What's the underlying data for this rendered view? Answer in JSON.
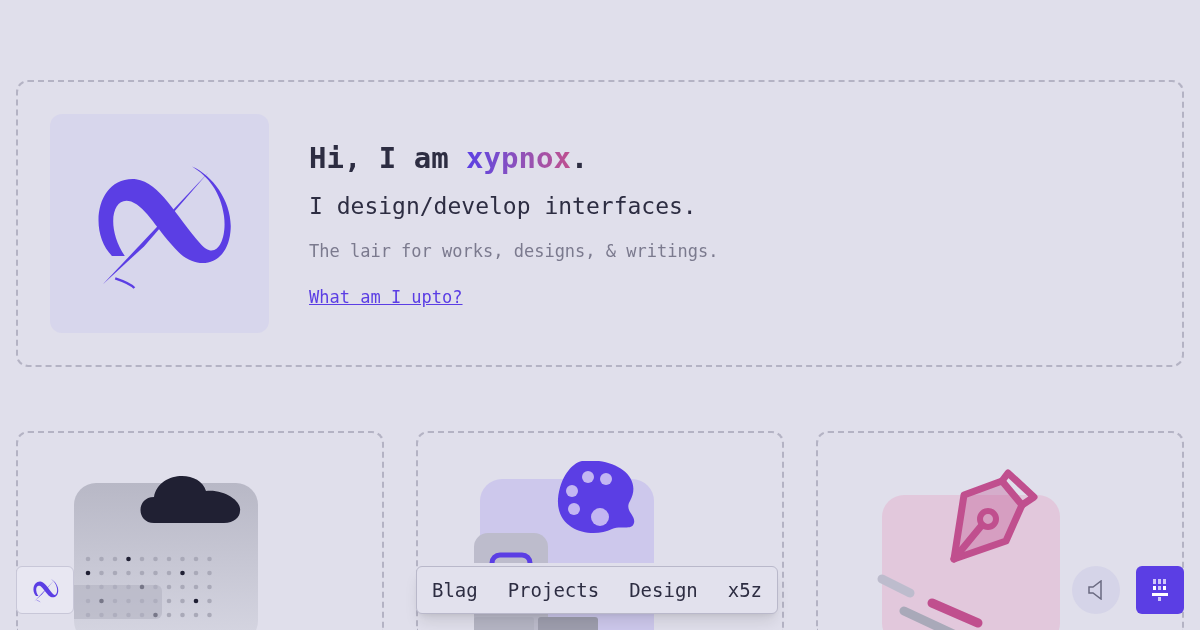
{
  "hero": {
    "greeting": "Hi, I am",
    "name": "xypnox",
    "punctuation": ".",
    "tagline": "I design/develop interfaces.",
    "description": "The lair for works, designs, & writings.",
    "link": "What am I upto?"
  },
  "cards": [
    {
      "kind": "cloud"
    },
    {
      "kind": "palette"
    },
    {
      "kind": "pen"
    }
  ],
  "nav": {
    "items": [
      {
        "label": "Blag"
      },
      {
        "label": "Projects"
      },
      {
        "label": "Design"
      },
      {
        "label": "x5z"
      }
    ]
  }
}
